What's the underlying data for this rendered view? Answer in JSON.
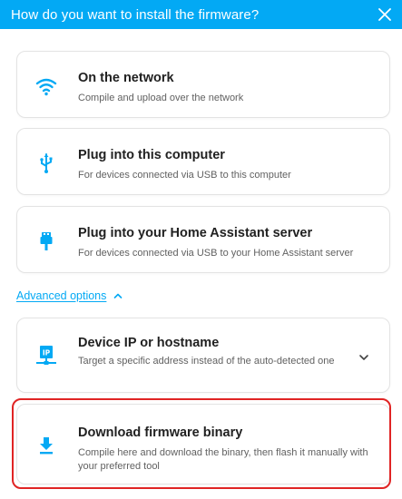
{
  "header": {
    "title": "How do you want to install the firmware?",
    "close_icon": "close-icon"
  },
  "options": [
    {
      "title": "On the network",
      "subtitle": "Compile and upload over the network",
      "icon": "wifi-icon"
    },
    {
      "title": "Plug into this computer",
      "subtitle": "For devices connected via USB to this computer",
      "icon": "usb-icon"
    },
    {
      "title": "Plug into your Home Assistant server",
      "subtitle": "For devices connected via USB to your Home Assistant server",
      "icon": "usb-plug-icon"
    }
  ],
  "advanced": {
    "label": "Advanced options",
    "icon": "chevron-up-icon"
  },
  "advanced_options": [
    {
      "title": "Device IP or hostname",
      "subtitle": "Target a specific address instead of the auto-detected one",
      "icon": "ip-network-icon",
      "chevron": "chevron-down-icon"
    },
    {
      "title": "Download firmware binary",
      "subtitle": "Compile here and download the binary, then flash it manually with your preferred tool",
      "icon": "download-icon"
    }
  ],
  "colors": {
    "accent": "#03a9f4",
    "highlight": "#e02424",
    "text": "#212121",
    "secondary_text": "#616161"
  }
}
